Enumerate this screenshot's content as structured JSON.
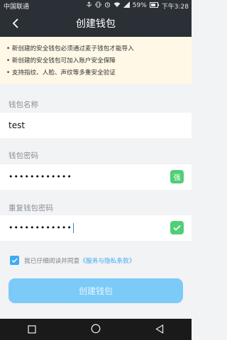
{
  "status_bar": {
    "carrier": "中国联通",
    "battery": "59%",
    "time": "下午3:28",
    "icons": [
      "usb-icon",
      "vibrate-icon",
      "alarm-icon",
      "wifi-icon",
      "signal-icon",
      "battery-icon"
    ]
  },
  "header": {
    "title": "创建钱包",
    "back_icon": "back-arrow-icon"
  },
  "notice": {
    "lines": [
      "• 新创建的安全钱包必须通过麦子钱包才能导入",
      "• 新创建的安全钱包可加入账户安全保障",
      "• 支持指纹、人脸、声纹等多重安全验证"
    ]
  },
  "form": {
    "wallet_name_label": "钱包名称",
    "wallet_name_value": "test",
    "password_label": "钱包密码",
    "password_value": "••••••••••••",
    "password_strength": "强",
    "repeat_label": "重复钱包密码",
    "repeat_value": "••••••••••••",
    "repeat_status_icon": "check-icon"
  },
  "agreement": {
    "checked": true,
    "text": "我已仔细阅读并同意",
    "link": "《服务与隐私条款》"
  },
  "create_button": "创建钱包",
  "colors": {
    "header_bg": "#2b3036",
    "notice_bg": "#fff8e7",
    "accent": "#3fa9f5",
    "button_bg": "#7ccaf8",
    "success_green": "#4fcf76"
  },
  "nav_bar": [
    "square-icon",
    "circle-icon",
    "triangle-back-icon"
  ]
}
